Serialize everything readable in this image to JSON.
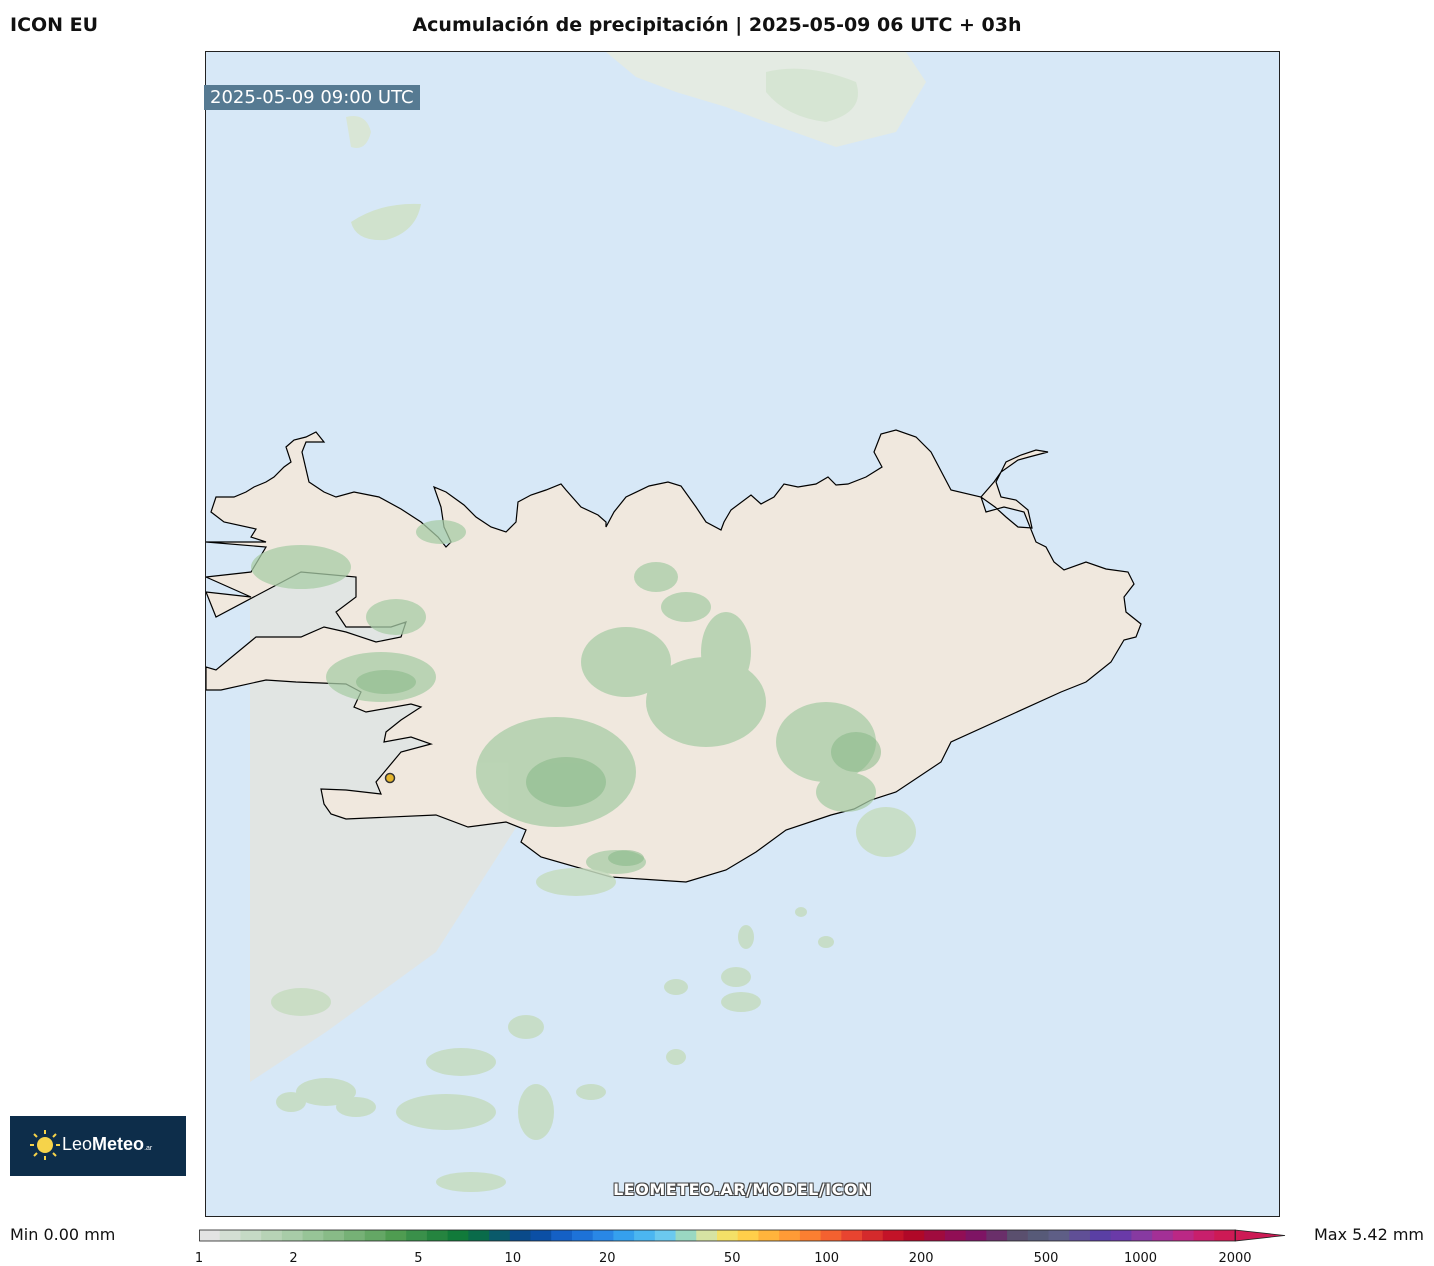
{
  "header": {
    "model": "ICON EU",
    "title": "Acumulación de precipitación | 2025-05-09 06 UTC + 03h"
  },
  "map": {
    "valid_time": "2025-05-09 09:00 UTC",
    "watermark": "LEOMETEO.AR/MODEL/ICON",
    "colors": {
      "ocean": "#d7e8f7",
      "land": "#f0e8de",
      "precip_light": "#cfe2cc",
      "precip_mid": "#a9cda7",
      "precip_strong": "#86b887",
      "coast": "#000000",
      "marker": "#e5b52c"
    }
  },
  "logo": {
    "name_light": "Leo",
    "name_bold": "Meteo",
    "suffix": ".ar"
  },
  "legend": {
    "min_label": "Min 0.00 mm",
    "max_label": "Max 5.42 mm",
    "ticks": [
      "1",
      "2",
      "5",
      "10",
      "20",
      "50",
      "100",
      "200",
      "500",
      "1000",
      "2000"
    ],
    "colors": [
      "#e3e3e3",
      "#d3dfd3",
      "#c5dac5",
      "#b7d3b6",
      "#a8cca8",
      "#97c497",
      "#88bb87",
      "#76b176",
      "#64a765",
      "#4f9c51",
      "#3a904a",
      "#25843f",
      "#117a3a",
      "#0a6b4a",
      "#0a5a6a",
      "#0a4a8a",
      "#0b4fa5",
      "#1460c5",
      "#1d72d8",
      "#2987e6",
      "#35a0ee",
      "#4bb6f1",
      "#6bc9ef",
      "#9ad8c2",
      "#d6e3a3",
      "#f4e067",
      "#ffcf4a",
      "#ffb43c",
      "#ff9b36",
      "#fb7f31",
      "#f46130",
      "#e84430",
      "#d42a2c",
      "#c31328",
      "#b00828",
      "#a00b3e",
      "#910e55",
      "#7e1464",
      "#6a2f6a",
      "#5a4f6e",
      "#575a78",
      "#5e5e86",
      "#604f96",
      "#5a3fa4",
      "#6a3aa8",
      "#873aa1",
      "#a33096",
      "#bb2885",
      "#c81f6c",
      "#cd1a55"
    ]
  }
}
